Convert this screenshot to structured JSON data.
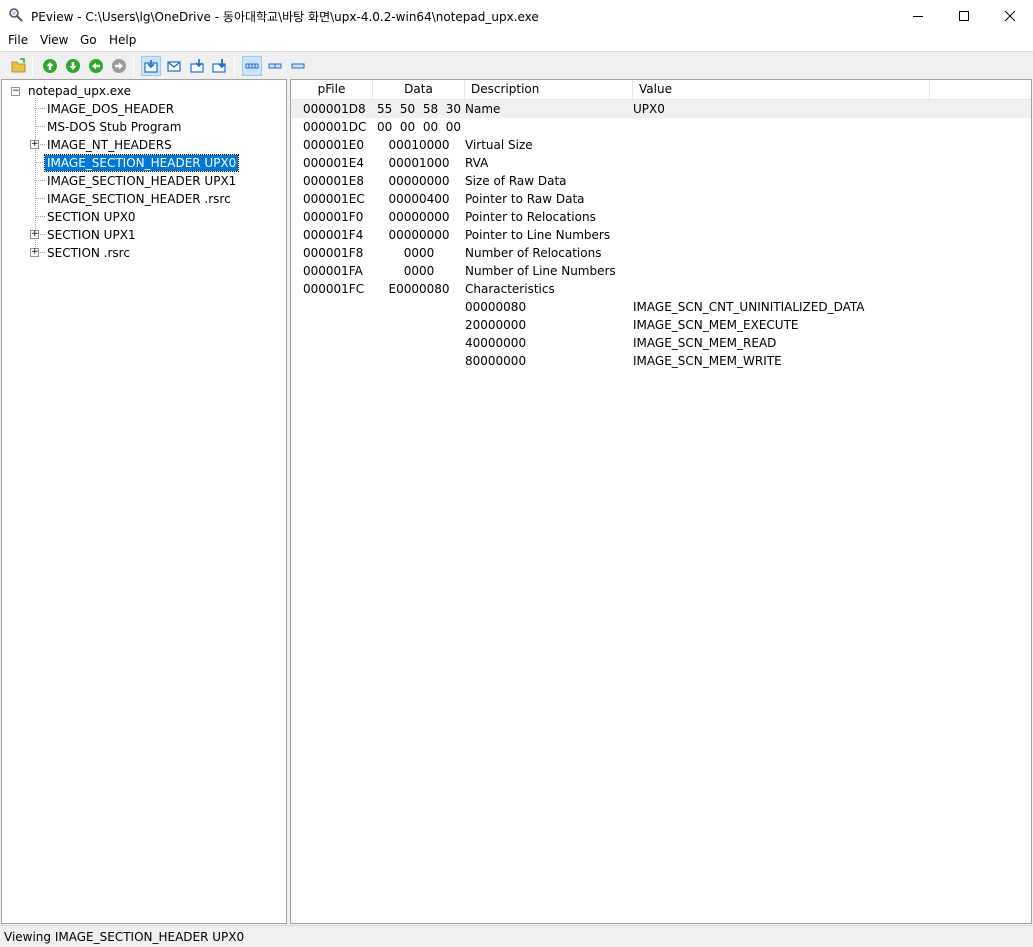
{
  "window": {
    "title": "PEview - C:\\Users\\lg\\OneDrive - 동아대학교\\바탕 화면\\upx-4.0.2-win64\\notepad_upx.exe",
    "minimize_icon": "minimize-icon",
    "maximize_icon": "maximize-icon",
    "close_icon": "close-icon"
  },
  "menu": {
    "items": [
      "File",
      "View",
      "Go",
      "Help"
    ]
  },
  "toolbar": {
    "buttons": [
      "open-file-icon",
      "back-icon",
      "forward-icon",
      "up-icon",
      "down-icon",
      "view-byte-icon",
      "view-word-icon",
      "view-dword-icon",
      "view-qword-icon",
      "view-details-icon",
      "view-small-icon",
      "view-large-icon"
    ]
  },
  "tree": {
    "root": "notepad_upx.exe",
    "items": [
      {
        "label": "IMAGE_DOS_HEADER",
        "expandable": false
      },
      {
        "label": "MS-DOS Stub Program",
        "expandable": false
      },
      {
        "label": "IMAGE_NT_HEADERS",
        "expandable": true
      },
      {
        "label": "IMAGE_SECTION_HEADER UPX0",
        "expandable": false,
        "selected": true
      },
      {
        "label": "IMAGE_SECTION_HEADER UPX1",
        "expandable": false
      },
      {
        "label": "IMAGE_SECTION_HEADER .rsrc",
        "expandable": false
      },
      {
        "label": "SECTION UPX0",
        "expandable": false
      },
      {
        "label": "SECTION UPX1",
        "expandable": true
      },
      {
        "label": "SECTION .rsrc",
        "expandable": true
      }
    ]
  },
  "table": {
    "columns": [
      "pFile",
      "Data",
      "Description",
      "Value"
    ],
    "rows": [
      {
        "pfile": "000001D8",
        "data": "55  50  58  30",
        "desc": "Name",
        "value": "UPX0"
      },
      {
        "pfile": "000001DC",
        "data": "00  00  00  00",
        "desc": "",
        "value": ""
      },
      {
        "pfile": "000001E0",
        "data": "00010000",
        "desc": "Virtual Size",
        "value": ""
      },
      {
        "pfile": "000001E4",
        "data": "00001000",
        "desc": "RVA",
        "value": ""
      },
      {
        "pfile": "000001E8",
        "data": "00000000",
        "desc": "Size of Raw Data",
        "value": ""
      },
      {
        "pfile": "000001EC",
        "data": "00000400",
        "desc": "Pointer to Raw Data",
        "value": ""
      },
      {
        "pfile": "000001F0",
        "data": "00000000",
        "desc": "Pointer to Relocations",
        "value": ""
      },
      {
        "pfile": "000001F4",
        "data": "00000000",
        "desc": "Pointer to Line Numbers",
        "value": ""
      },
      {
        "pfile": "000001F8",
        "data": "0000",
        "desc": "Number of Relocations",
        "value": ""
      },
      {
        "pfile": "000001FA",
        "data": "0000",
        "desc": "Number of Line Numbers",
        "value": ""
      },
      {
        "pfile": "000001FC",
        "data": "E0000080",
        "desc": "Characteristics",
        "value": ""
      },
      {
        "pfile": "",
        "data": "",
        "desc": "00000080",
        "value": "IMAGE_SCN_CNT_UNINITIALIZED_DATA"
      },
      {
        "pfile": "",
        "data": "",
        "desc": "20000000",
        "value": "IMAGE_SCN_MEM_EXECUTE"
      },
      {
        "pfile": "",
        "data": "",
        "desc": "40000000",
        "value": "IMAGE_SCN_MEM_READ"
      },
      {
        "pfile": "",
        "data": "",
        "desc": "80000000",
        "value": "IMAGE_SCN_MEM_WRITE"
      }
    ]
  },
  "status": {
    "text": "Viewing IMAGE_SECTION_HEADER UPX0"
  },
  "colors": {
    "selection": "#0078d7",
    "accent_green": "#2fa82f",
    "accent_blue": "#1c6fd0"
  }
}
